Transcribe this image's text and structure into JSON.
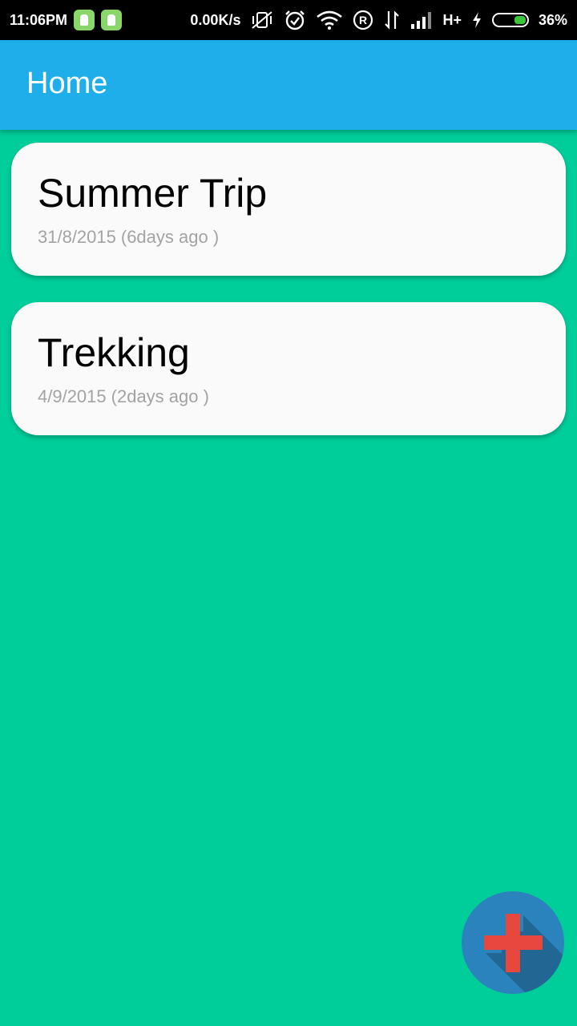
{
  "status_bar": {
    "time": "11:06PM",
    "net_speed": "0.00K/s",
    "network_type": "H+",
    "battery_percent": "36%",
    "battery_level": 0.36,
    "icons": [
      "notification-app-icon",
      "notification-app-icon",
      "vibrate-off-icon",
      "alarm-icon",
      "wifi-icon",
      "roaming-icon",
      "data-transfer-icon",
      "signal-icon",
      "charging-icon",
      "battery-icon"
    ]
  },
  "appbar": {
    "title": "Home",
    "color": "#1EAEEA"
  },
  "background_color": "#00CE9A",
  "trips": [
    {
      "title": "Summer Trip",
      "date": "31/8/2015",
      "ago": "(6days ago )"
    },
    {
      "title": "Trekking",
      "date": "4/9/2015",
      "ago": "(2days ago )"
    }
  ],
  "fab": {
    "icon": "plus-icon",
    "color": "#2B83BD",
    "plus_color": "#E8473E"
  }
}
